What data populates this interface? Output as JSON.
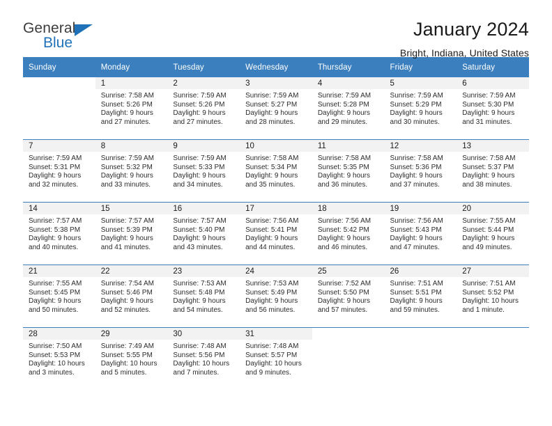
{
  "brand": {
    "name_top": "General",
    "name_bottom": "Blue",
    "triangle_color": "#1f72b8"
  },
  "header": {
    "title": "January 2024",
    "location": "Bright, Indiana, United States"
  },
  "theme": {
    "header_blue": "#3b7fbe",
    "band_gray": "#f2f2f2",
    "text": "#1a1a1a"
  },
  "weekdays": [
    "Sunday",
    "Monday",
    "Tuesday",
    "Wednesday",
    "Thursday",
    "Friday",
    "Saturday"
  ],
  "weeks": [
    [
      {
        "day": "",
        "sunrise": "",
        "sunset": "",
        "daylight_line1": "",
        "daylight_line2": "",
        "blank": true
      },
      {
        "day": "1",
        "sunrise": "Sunrise: 7:58 AM",
        "sunset": "Sunset: 5:26 PM",
        "daylight_line1": "Daylight: 9 hours",
        "daylight_line2": "and 27 minutes."
      },
      {
        "day": "2",
        "sunrise": "Sunrise: 7:59 AM",
        "sunset": "Sunset: 5:26 PM",
        "daylight_line1": "Daylight: 9 hours",
        "daylight_line2": "and 27 minutes."
      },
      {
        "day": "3",
        "sunrise": "Sunrise: 7:59 AM",
        "sunset": "Sunset: 5:27 PM",
        "daylight_line1": "Daylight: 9 hours",
        "daylight_line2": "and 28 minutes."
      },
      {
        "day": "4",
        "sunrise": "Sunrise: 7:59 AM",
        "sunset": "Sunset: 5:28 PM",
        "daylight_line1": "Daylight: 9 hours",
        "daylight_line2": "and 29 minutes."
      },
      {
        "day": "5",
        "sunrise": "Sunrise: 7:59 AM",
        "sunset": "Sunset: 5:29 PM",
        "daylight_line1": "Daylight: 9 hours",
        "daylight_line2": "and 30 minutes."
      },
      {
        "day": "6",
        "sunrise": "Sunrise: 7:59 AM",
        "sunset": "Sunset: 5:30 PM",
        "daylight_line1": "Daylight: 9 hours",
        "daylight_line2": "and 31 minutes."
      }
    ],
    [
      {
        "day": "7",
        "sunrise": "Sunrise: 7:59 AM",
        "sunset": "Sunset: 5:31 PM",
        "daylight_line1": "Daylight: 9 hours",
        "daylight_line2": "and 32 minutes."
      },
      {
        "day": "8",
        "sunrise": "Sunrise: 7:59 AM",
        "sunset": "Sunset: 5:32 PM",
        "daylight_line1": "Daylight: 9 hours",
        "daylight_line2": "and 33 minutes."
      },
      {
        "day": "9",
        "sunrise": "Sunrise: 7:59 AM",
        "sunset": "Sunset: 5:33 PM",
        "daylight_line1": "Daylight: 9 hours",
        "daylight_line2": "and 34 minutes."
      },
      {
        "day": "10",
        "sunrise": "Sunrise: 7:58 AM",
        "sunset": "Sunset: 5:34 PM",
        "daylight_line1": "Daylight: 9 hours",
        "daylight_line2": "and 35 minutes."
      },
      {
        "day": "11",
        "sunrise": "Sunrise: 7:58 AM",
        "sunset": "Sunset: 5:35 PM",
        "daylight_line1": "Daylight: 9 hours",
        "daylight_line2": "and 36 minutes."
      },
      {
        "day": "12",
        "sunrise": "Sunrise: 7:58 AM",
        "sunset": "Sunset: 5:36 PM",
        "daylight_line1": "Daylight: 9 hours",
        "daylight_line2": "and 37 minutes."
      },
      {
        "day": "13",
        "sunrise": "Sunrise: 7:58 AM",
        "sunset": "Sunset: 5:37 PM",
        "daylight_line1": "Daylight: 9 hours",
        "daylight_line2": "and 38 minutes."
      }
    ],
    [
      {
        "day": "14",
        "sunrise": "Sunrise: 7:57 AM",
        "sunset": "Sunset: 5:38 PM",
        "daylight_line1": "Daylight: 9 hours",
        "daylight_line2": "and 40 minutes."
      },
      {
        "day": "15",
        "sunrise": "Sunrise: 7:57 AM",
        "sunset": "Sunset: 5:39 PM",
        "daylight_line1": "Daylight: 9 hours",
        "daylight_line2": "and 41 minutes."
      },
      {
        "day": "16",
        "sunrise": "Sunrise: 7:57 AM",
        "sunset": "Sunset: 5:40 PM",
        "daylight_line1": "Daylight: 9 hours",
        "daylight_line2": "and 43 minutes."
      },
      {
        "day": "17",
        "sunrise": "Sunrise: 7:56 AM",
        "sunset": "Sunset: 5:41 PM",
        "daylight_line1": "Daylight: 9 hours",
        "daylight_line2": "and 44 minutes."
      },
      {
        "day": "18",
        "sunrise": "Sunrise: 7:56 AM",
        "sunset": "Sunset: 5:42 PM",
        "daylight_line1": "Daylight: 9 hours",
        "daylight_line2": "and 46 minutes."
      },
      {
        "day": "19",
        "sunrise": "Sunrise: 7:56 AM",
        "sunset": "Sunset: 5:43 PM",
        "daylight_line1": "Daylight: 9 hours",
        "daylight_line2": "and 47 minutes."
      },
      {
        "day": "20",
        "sunrise": "Sunrise: 7:55 AM",
        "sunset": "Sunset: 5:44 PM",
        "daylight_line1": "Daylight: 9 hours",
        "daylight_line2": "and 49 minutes."
      }
    ],
    [
      {
        "day": "21",
        "sunrise": "Sunrise: 7:55 AM",
        "sunset": "Sunset: 5:45 PM",
        "daylight_line1": "Daylight: 9 hours",
        "daylight_line2": "and 50 minutes."
      },
      {
        "day": "22",
        "sunrise": "Sunrise: 7:54 AM",
        "sunset": "Sunset: 5:46 PM",
        "daylight_line1": "Daylight: 9 hours",
        "daylight_line2": "and 52 minutes."
      },
      {
        "day": "23",
        "sunrise": "Sunrise: 7:53 AM",
        "sunset": "Sunset: 5:48 PM",
        "daylight_line1": "Daylight: 9 hours",
        "daylight_line2": "and 54 minutes."
      },
      {
        "day": "24",
        "sunrise": "Sunrise: 7:53 AM",
        "sunset": "Sunset: 5:49 PM",
        "daylight_line1": "Daylight: 9 hours",
        "daylight_line2": "and 56 minutes."
      },
      {
        "day": "25",
        "sunrise": "Sunrise: 7:52 AM",
        "sunset": "Sunset: 5:50 PM",
        "daylight_line1": "Daylight: 9 hours",
        "daylight_line2": "and 57 minutes."
      },
      {
        "day": "26",
        "sunrise": "Sunrise: 7:51 AM",
        "sunset": "Sunset: 5:51 PM",
        "daylight_line1": "Daylight: 9 hours",
        "daylight_line2": "and 59 minutes."
      },
      {
        "day": "27",
        "sunrise": "Sunrise: 7:51 AM",
        "sunset": "Sunset: 5:52 PM",
        "daylight_line1": "Daylight: 10 hours",
        "daylight_line2": "and 1 minute."
      }
    ],
    [
      {
        "day": "28",
        "sunrise": "Sunrise: 7:50 AM",
        "sunset": "Sunset: 5:53 PM",
        "daylight_line1": "Daylight: 10 hours",
        "daylight_line2": "and 3 minutes."
      },
      {
        "day": "29",
        "sunrise": "Sunrise: 7:49 AM",
        "sunset": "Sunset: 5:55 PM",
        "daylight_line1": "Daylight: 10 hours",
        "daylight_line2": "and 5 minutes."
      },
      {
        "day": "30",
        "sunrise": "Sunrise: 7:48 AM",
        "sunset": "Sunset: 5:56 PM",
        "daylight_line1": "Daylight: 10 hours",
        "daylight_line2": "and 7 minutes."
      },
      {
        "day": "31",
        "sunrise": "Sunrise: 7:48 AM",
        "sunset": "Sunset: 5:57 PM",
        "daylight_line1": "Daylight: 10 hours",
        "daylight_line2": "and 9 minutes."
      },
      {
        "day": "",
        "sunrise": "",
        "sunset": "",
        "daylight_line1": "",
        "daylight_line2": "",
        "blank": true
      },
      {
        "day": "",
        "sunrise": "",
        "sunset": "",
        "daylight_line1": "",
        "daylight_line2": "",
        "blank": true
      },
      {
        "day": "",
        "sunrise": "",
        "sunset": "",
        "daylight_line1": "",
        "daylight_line2": "",
        "blank": true
      }
    ]
  ]
}
